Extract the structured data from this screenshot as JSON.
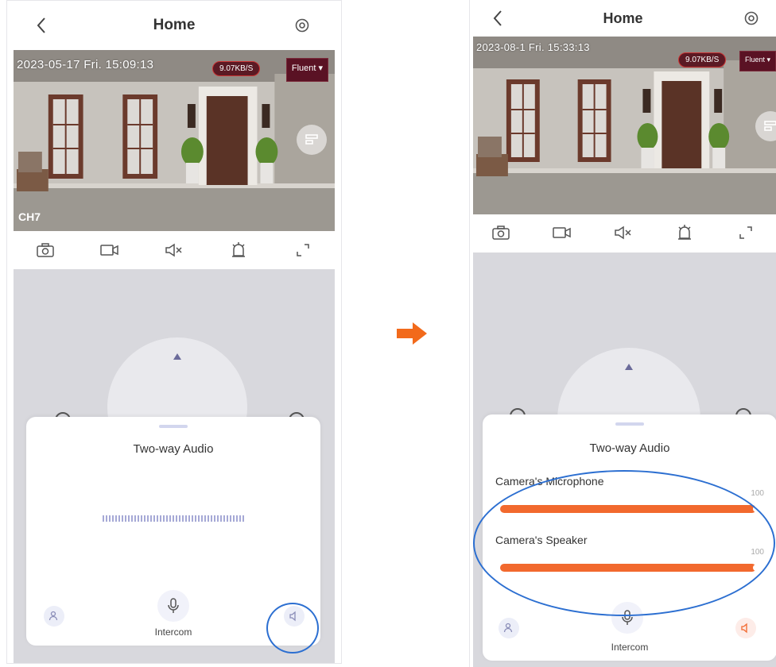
{
  "before": {
    "header": {
      "title": "Home"
    },
    "video": {
      "timestamp": "2023-05-17  Fri.   15:09:13",
      "speed": "9.07KB/S",
      "quality": "Fluent ▾",
      "channel": "CH7"
    },
    "sheet": {
      "title": "Two-way Audio",
      "intercom_label": "Intercom"
    }
  },
  "after": {
    "header": {
      "title": "Home"
    },
    "video": {
      "timestamp": "2023-08-1  Fri.   15:33:13",
      "speed": "9.07KB/S",
      "quality": "Fluent ▾"
    },
    "sheet": {
      "title": "Two-way Audio",
      "microphone_label": "Camera's Microphone",
      "microphone_value": "100",
      "speaker_label": "Camera's Speaker",
      "speaker_value": "100",
      "intercom_label": "Intercom"
    }
  },
  "colors": {
    "accent_orange": "#f2692e",
    "highlight_blue": "#2c6fd1",
    "arrow": "#f26a1b"
  },
  "icons": [
    "back-arrow-icon",
    "settings-icon",
    "camera-icon",
    "record-icon",
    "mute-icon",
    "alarm-icon",
    "fullscreen-icon",
    "split-screen-icon",
    "person-icon",
    "microphone-icon",
    "speaker-icon",
    "right-arrow-icon"
  ]
}
